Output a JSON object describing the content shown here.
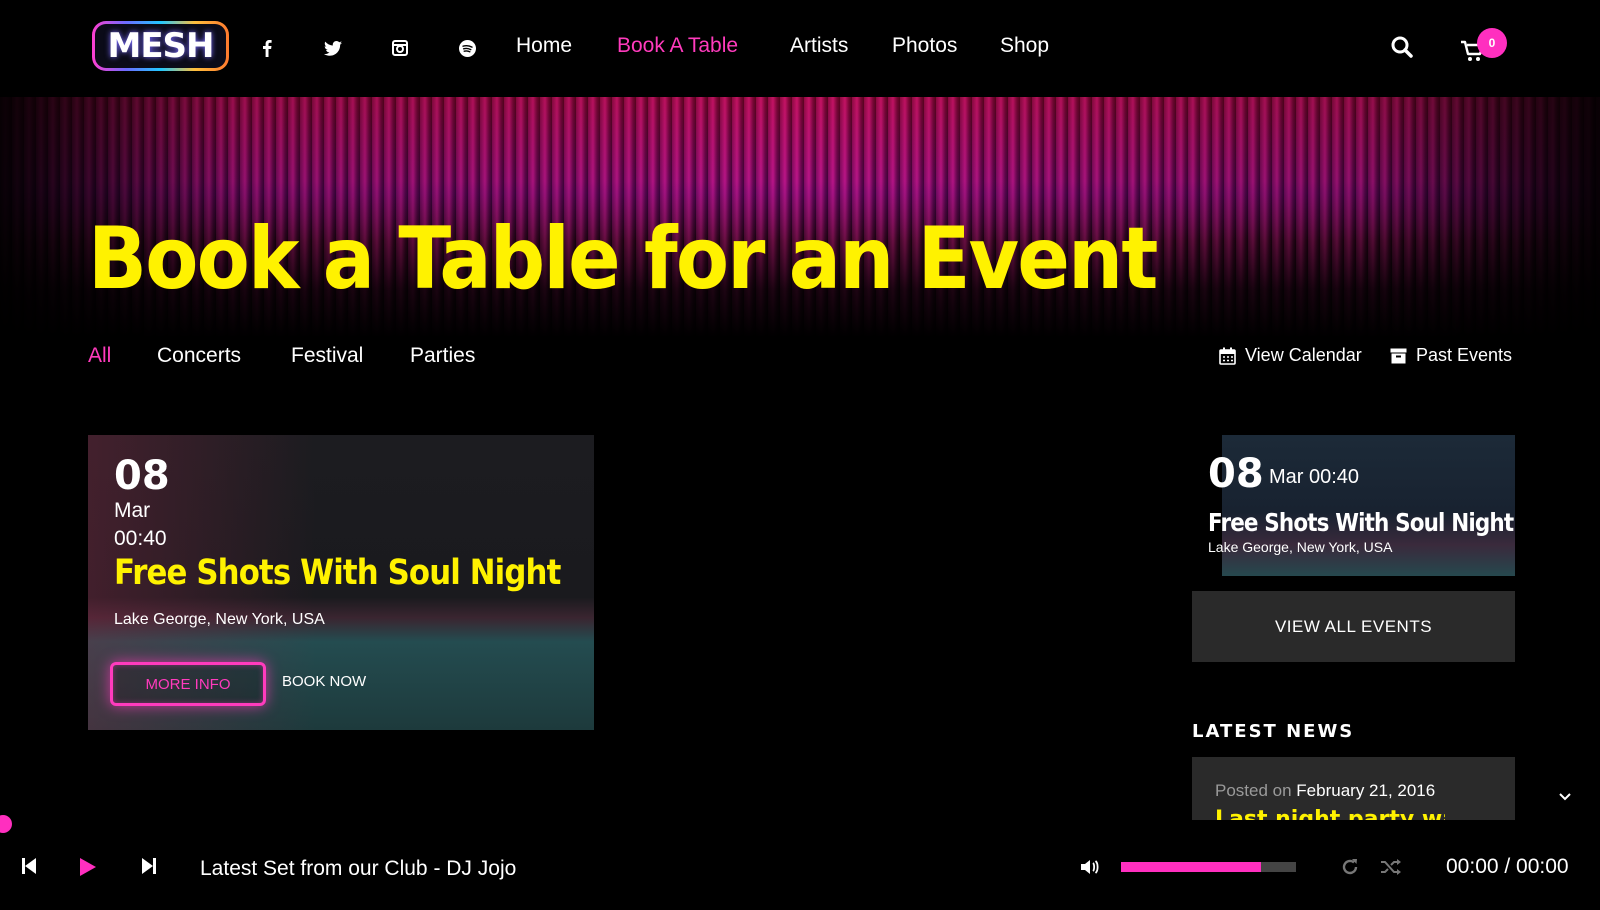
{
  "header": {
    "logo_text": "MESH",
    "social": [
      "facebook-icon",
      "twitter-icon",
      "instagram-icon",
      "spotify-icon"
    ],
    "nav": [
      {
        "label": "Home",
        "active": false
      },
      {
        "label": "Book A Table",
        "active": true
      },
      {
        "label": "Artists",
        "active": false
      },
      {
        "label": "Photos",
        "active": false
      },
      {
        "label": "Shop",
        "active": false
      }
    ],
    "cart_count": "0"
  },
  "hero": {
    "title": "Book a Table for an Event"
  },
  "filters": {
    "items": [
      {
        "label": "All",
        "active": true
      },
      {
        "label": "Concerts",
        "active": false
      },
      {
        "label": "Festival",
        "active": false
      },
      {
        "label": "Parties",
        "active": false
      }
    ],
    "view_calendar": "View Calendar",
    "past_events": "Past Events"
  },
  "event_card": {
    "day": "08",
    "month": "Mar",
    "time": "00:40",
    "title": "Free Shots With Soul Night",
    "location": "Lake George, New York, USA",
    "more_info": "MORE INFO",
    "book_now": "BOOK NOW"
  },
  "sidebar": {
    "event": {
      "day": "08",
      "date": "Mar 00:40",
      "title": "Free Shots With Soul Night",
      "location": "Lake George, New York, USA"
    },
    "view_all": "VIEW ALL EVENTS",
    "news_heading": "LATEST NEWS",
    "news": {
      "posted_prefix": "Posted on",
      "date": "February 21, 2016",
      "title": "Last night party was a"
    }
  },
  "player": {
    "track": "Latest Set from our Club - DJ Jojo",
    "time": "00:00 / 00:00",
    "volume": 0.8
  },
  "colors": {
    "accent": "#ff3bbd",
    "title_yellow": "#fff200",
    "background": "#000000",
    "panel": "#2a2a2a"
  }
}
